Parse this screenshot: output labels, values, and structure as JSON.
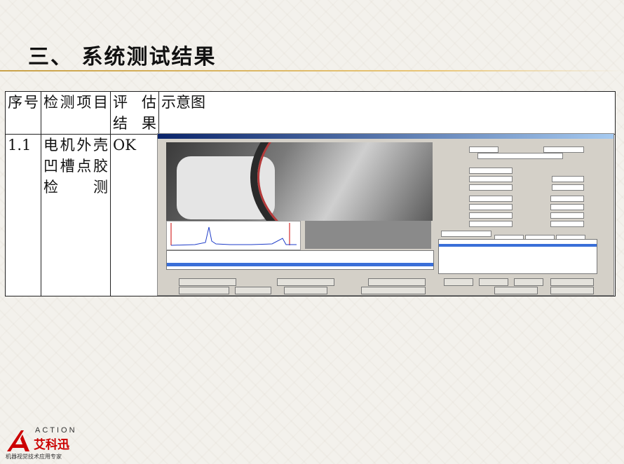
{
  "slide": {
    "title": "三、 系统测试结果"
  },
  "table": {
    "headers": [
      "序号",
      "检测项目",
      "评估结果",
      "示意图"
    ],
    "rows": [
      {
        "no": "1.1",
        "item": "电机外壳凹槽点胶检测",
        "result": "OK"
      }
    ]
  },
  "logo": {
    "wordmark": "ACTION",
    "brand": "艾科迅",
    "tagline": "机器视觉技术应用专家",
    "color": "#cc0000"
  }
}
